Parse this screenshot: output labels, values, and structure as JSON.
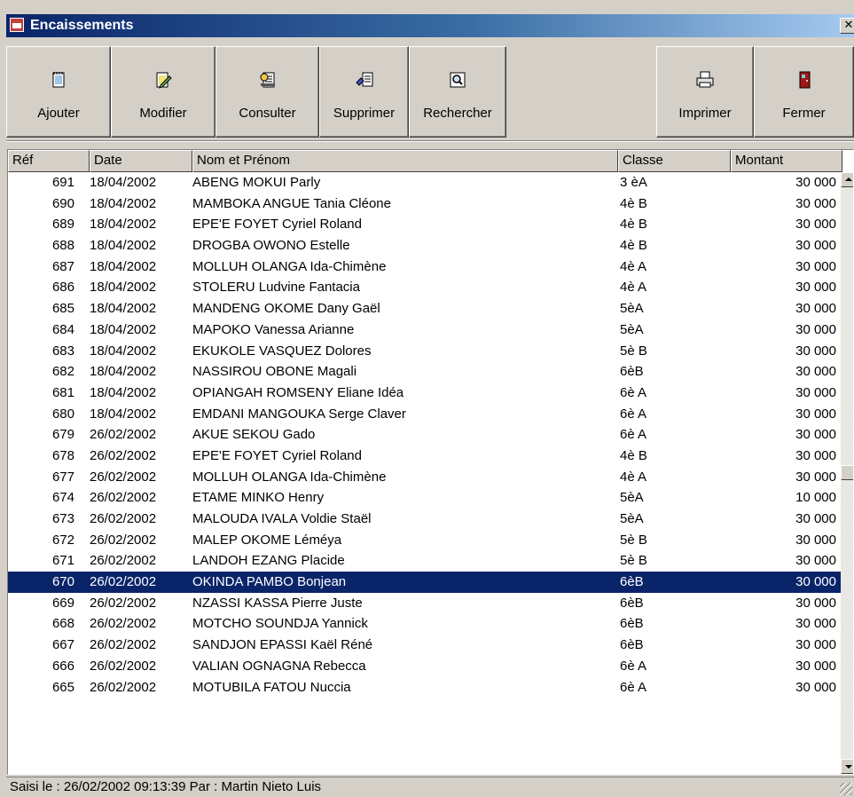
{
  "window": {
    "title": "Encaissements",
    "close_glyph": "✕"
  },
  "toolbar": {
    "add": {
      "label": "Ajouter",
      "icon": "notepad-icon"
    },
    "modify": {
      "label": "Modifier",
      "icon": "edit-notepad-icon"
    },
    "consult": {
      "label": "Consulter",
      "icon": "view-document-icon"
    },
    "delete": {
      "label": "Supprimer",
      "icon": "delete-document-icon"
    },
    "search": {
      "label": "Rechercher",
      "icon": "magnifier-icon"
    },
    "print": {
      "label": "Imprimer",
      "icon": "printer-icon"
    },
    "close": {
      "label": "Fermer",
      "icon": "door-icon"
    }
  },
  "grid": {
    "columns": {
      "ref": "Réf",
      "date": "Date",
      "name": "Nom et Prénom",
      "class": "Classe",
      "amount": "Montant"
    },
    "selected_ref": "670",
    "rows": [
      {
        "ref": "691",
        "date": "18/04/2002",
        "name": "ABENG MOKUI Parly",
        "cls": "3 èA",
        "amount": "30 000"
      },
      {
        "ref": "690",
        "date": "18/04/2002",
        "name": "MAMBOKA ANGUE Tania Cléone",
        "cls": "4è B",
        "amount": "30 000"
      },
      {
        "ref": "689",
        "date": "18/04/2002",
        "name": "EPE'E FOYET Cyriel Roland",
        "cls": "4è B",
        "amount": "30 000"
      },
      {
        "ref": "688",
        "date": "18/04/2002",
        "name": "DROGBA OWONO Estelle",
        "cls": "4è B",
        "amount": "30 000"
      },
      {
        "ref": "687",
        "date": "18/04/2002",
        "name": "MOLLUH OLANGA Ida-Chimène",
        "cls": "4è A",
        "amount": "30 000"
      },
      {
        "ref": "686",
        "date": "18/04/2002",
        "name": "STOLERU Ludvine Fantacia",
        "cls": "4è A",
        "amount": "30 000"
      },
      {
        "ref": "685",
        "date": "18/04/2002",
        "name": "MANDENG OKOME Dany Gaël",
        "cls": "5èA",
        "amount": "30 000"
      },
      {
        "ref": "684",
        "date": "18/04/2002",
        "name": "MAPOKO Vanessa Arianne",
        "cls": "5èA",
        "amount": "30 000"
      },
      {
        "ref": "683",
        "date": "18/04/2002",
        "name": "EKUKOLE VASQUEZ Dolores",
        "cls": "5è B",
        "amount": "30 000"
      },
      {
        "ref": "682",
        "date": "18/04/2002",
        "name": "NASSIROU OBONE Magali",
        "cls": "6èB",
        "amount": "30 000"
      },
      {
        "ref": "681",
        "date": "18/04/2002",
        "name": "OPIANGAH ROMSENY Eliane Idéa",
        "cls": "6è A",
        "amount": "30 000"
      },
      {
        "ref": "680",
        "date": "18/04/2002",
        "name": "EMDANI MANGOUKA Serge Claver",
        "cls": "6è A",
        "amount": "30 000"
      },
      {
        "ref": "679",
        "date": "26/02/2002",
        "name": "AKUE SEKOU Gado",
        "cls": "6è A",
        "amount": "30 000"
      },
      {
        "ref": "678",
        "date": "26/02/2002",
        "name": "EPE'E FOYET Cyriel Roland",
        "cls": "4è B",
        "amount": "30 000"
      },
      {
        "ref": "677",
        "date": "26/02/2002",
        "name": "MOLLUH OLANGA Ida-Chimène",
        "cls": "4è A",
        "amount": "30 000"
      },
      {
        "ref": "674",
        "date": "26/02/2002",
        "name": "ETAME MINKO Henry",
        "cls": "5èA",
        "amount": "10 000"
      },
      {
        "ref": "673",
        "date": "26/02/2002",
        "name": "MALOUDA IVALA Voldie Staël",
        "cls": "5èA",
        "amount": "30 000"
      },
      {
        "ref": "672",
        "date": "26/02/2002",
        "name": "MALEP OKOME Léméya",
        "cls": "5è B",
        "amount": "30 000"
      },
      {
        "ref": "671",
        "date": "26/02/2002",
        "name": "LANDOH EZANG Placide",
        "cls": "5è B",
        "amount": "30 000"
      },
      {
        "ref": "670",
        "date": "26/02/2002",
        "name": "OKINDA PAMBO Bonjean",
        "cls": "6èB",
        "amount": "30 000"
      },
      {
        "ref": "669",
        "date": "26/02/2002",
        "name": "NZASSI KASSA Pierre Juste",
        "cls": "6èB",
        "amount": "30 000"
      },
      {
        "ref": "668",
        "date": "26/02/2002",
        "name": "MOTCHO SOUNDJA Yannick",
        "cls": "6èB",
        "amount": "30 000"
      },
      {
        "ref": "667",
        "date": "26/02/2002",
        "name": "SANDJON EPASSI Kaël Réné",
        "cls": "6èB",
        "amount": "30 000"
      },
      {
        "ref": "666",
        "date": "26/02/2002",
        "name": "VALIAN OGNAGNA Rebecca",
        "cls": "6è A",
        "amount": "30 000"
      },
      {
        "ref": "665",
        "date": "26/02/2002",
        "name": "MOTUBILA FATOU Nuccia",
        "cls": "6è A",
        "amount": "30 000"
      }
    ]
  },
  "status": {
    "text": "Saisi le : 26/02/2002  09:13:39  Par : Martin Nieto Luis"
  },
  "colors": {
    "selection": "#0a246a",
    "titlebar_start": "#0a246a",
    "titlebar_end": "#a6caf0",
    "face": "#d4d0c8"
  }
}
